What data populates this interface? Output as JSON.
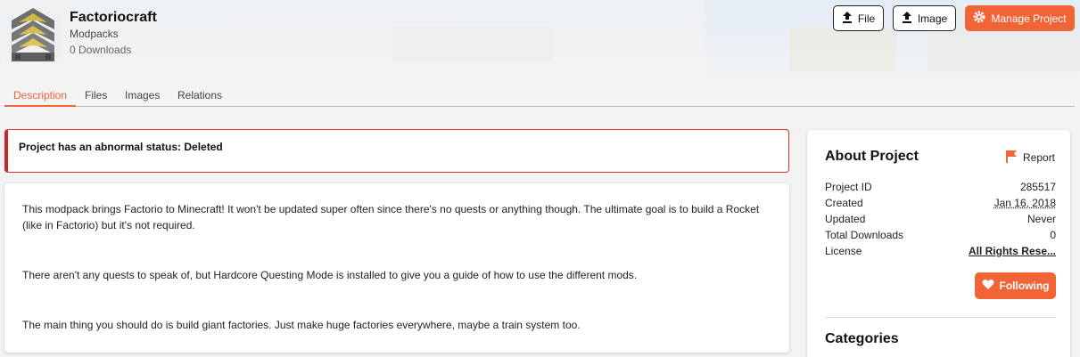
{
  "project": {
    "title": "Factoriocraft",
    "category": "Modpacks",
    "downloads": "0 Downloads"
  },
  "actions": {
    "file_label": "File",
    "image_label": "Image",
    "manage_label": "Manage Project"
  },
  "tabs": [
    {
      "label": "Description",
      "active": true
    },
    {
      "label": "Files"
    },
    {
      "label": "Images"
    },
    {
      "label": "Relations"
    }
  ],
  "alert": {
    "text": "Project has an abnormal status: Deleted"
  },
  "description": {
    "paragraphs": [
      "This modpack brings Factorio to Minecraft! It won't be updated super often since there's no quests or anything though. The ultimate goal is to build a Rocket (like in Factorio) but it's not required.",
      "There aren't any quests to speak of, but Hardcore Questing Mode is installed to give you a guide of how to use the different mods.",
      "The main thing you should do is build giant factories. Just make huge factories everywhere, maybe a train system too."
    ]
  },
  "about": {
    "title": "About Project",
    "report_label": "Report",
    "rows": [
      {
        "label": "Project ID",
        "value": "285517"
      },
      {
        "label": "Created",
        "value": "Jan 16, 2018"
      },
      {
        "label": "Updated",
        "value": "Never"
      },
      {
        "label": "Total Downloads",
        "value": "0"
      },
      {
        "label": "License",
        "value": "All Rights Rese..."
      }
    ],
    "following_label": "Following",
    "categories_title": "Categories"
  },
  "colors": {
    "accent": "#f16436",
    "alert_border": "#c62828"
  }
}
